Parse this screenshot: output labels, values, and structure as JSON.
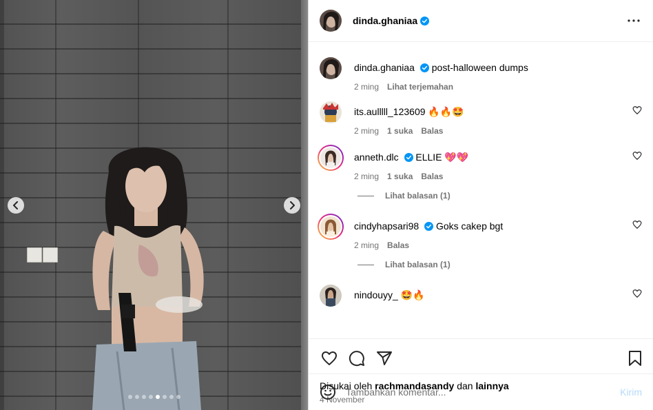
{
  "owner": {
    "username": "dinda.ghaniaa",
    "verified": true
  },
  "caption": {
    "username": "dinda.ghaniaa",
    "text": "post-halloween dumps",
    "time": "2 ming",
    "translate_label": "Lihat terjemahan"
  },
  "comments": [
    {
      "username": "its.aulllll_123609",
      "text": "🔥🔥🤩",
      "time": "2 ming",
      "likes": "1 suka",
      "reply_label": "Balas",
      "verified": false,
      "story_ring": false
    },
    {
      "username": "anneth.dlc",
      "text": "ELLIE 💖💖",
      "time": "2 ming",
      "likes": "1 suka",
      "reply_label": "Balas",
      "verified": true,
      "story_ring": true,
      "view_replies": "Lihat balasan (1)"
    },
    {
      "username": "cindyhapsari98",
      "text": "Goks cakep bgt",
      "time": "2 ming",
      "likes": "",
      "reply_label": "Balas",
      "verified": true,
      "story_ring": true,
      "view_replies": "Lihat balasan (1)"
    },
    {
      "username": "nindouyy_",
      "text": "🤩🔥",
      "verified": false,
      "story_ring": false
    }
  ],
  "liked_by": {
    "prefix": "Disukai oleh",
    "user": "rachmandasandy",
    "joiner": "dan",
    "others": "lainnya"
  },
  "date": "4 November",
  "composer": {
    "placeholder": "Tambahkan komentar...",
    "post_label": "Kirim"
  },
  "carousel": {
    "total": 8,
    "active_index": 4
  },
  "colors": {
    "verified": "#0095f6",
    "meta": "#737373",
    "post_disabled": "#b6d9fb"
  }
}
